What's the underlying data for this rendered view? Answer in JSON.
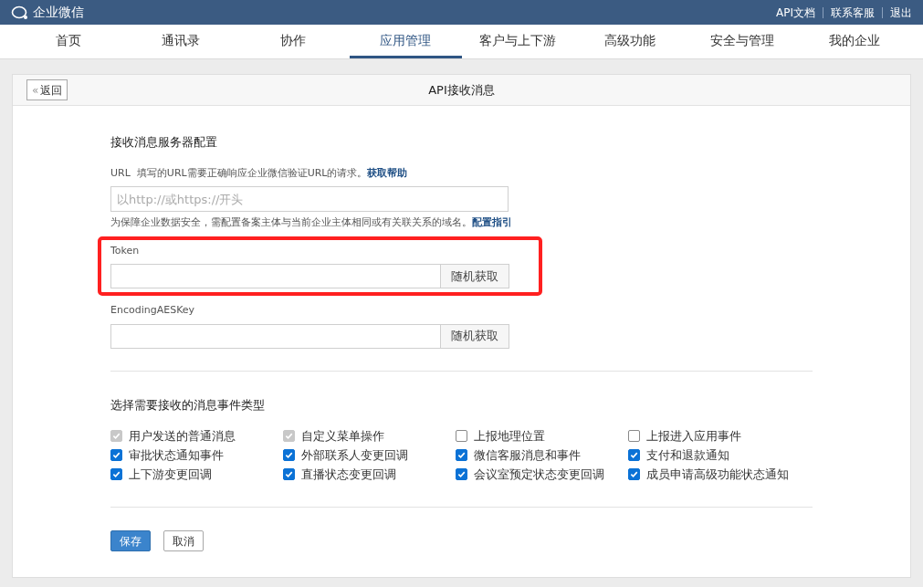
{
  "top_bar": {
    "logo": "企业微信",
    "links": [
      "API文档",
      "联系客服",
      "退出"
    ]
  },
  "nav": [
    {
      "label": "首页",
      "selected": false
    },
    {
      "label": "通讯录",
      "selected": false
    },
    {
      "label": "协作",
      "selected": false
    },
    {
      "label": "应用管理",
      "selected": true
    },
    {
      "label": "客户与上下游",
      "selected": false
    },
    {
      "label": "高级功能",
      "selected": false
    },
    {
      "label": "安全与管理",
      "selected": false
    },
    {
      "label": "我的企业",
      "selected": false
    }
  ],
  "panel": {
    "back_icon": "«",
    "back_button": "返回",
    "title": "API接收消息"
  },
  "server_config": {
    "heading": "接收消息服务器配置",
    "url_label": "URL",
    "url_hint": "填写的URL需要正确响应企业微信验证URL的请求。",
    "url_help_link": "获取帮助",
    "url_placeholder": "以http://或https://开头",
    "domain_note": "为保障企业数据安全，需配置备案主体与当前企业主体相同或有关联关系的域名。",
    "domain_link": "配置指引",
    "keys": [
      {
        "label": "Token",
        "button": "随机获取",
        "highlighted": true
      },
      {
        "label": "EncodingAESKey",
        "button": "随机获取",
        "highlighted": false
      }
    ]
  },
  "events": {
    "heading": "选择需要接收的消息事件类型",
    "options": [
      {
        "label": "用户发送的普通消息",
        "checked": true,
        "disabled": true
      },
      {
        "label": "自定义菜单操作",
        "checked": true,
        "disabled": true
      },
      {
        "label": "上报地理位置",
        "checked": false,
        "disabled": false
      },
      {
        "label": "上报进入应用事件",
        "checked": false,
        "disabled": false
      },
      {
        "label": "审批状态通知事件",
        "checked": true,
        "disabled": false
      },
      {
        "label": "外部联系人变更回调",
        "checked": true,
        "disabled": false
      },
      {
        "label": "微信客服消息和事件",
        "checked": true,
        "disabled": false
      },
      {
        "label": "支付和退款通知",
        "checked": true,
        "disabled": false
      },
      {
        "label": "上下游变更回调",
        "checked": true,
        "disabled": false
      },
      {
        "label": "直播状态变更回调",
        "checked": true,
        "disabled": false
      },
      {
        "label": "会议室预定状态变更回调",
        "checked": true,
        "disabled": false
      },
      {
        "label": "成员申请高级功能状态通知",
        "checked": true,
        "disabled": false
      }
    ]
  },
  "actions": {
    "save": "保存",
    "cancel": "取消"
  }
}
